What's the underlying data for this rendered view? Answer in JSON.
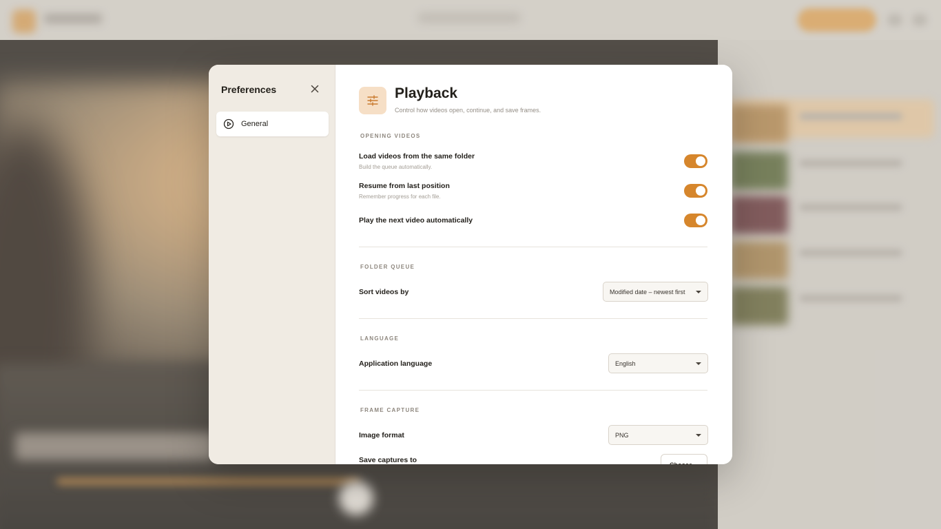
{
  "modal": {
    "title": "Preferences",
    "nav": [
      {
        "label": "General",
        "icon": "play-circle-icon",
        "active": true
      }
    ]
  },
  "page": {
    "title": "Playback",
    "subtitle": "Control how videos open, continue, and save frames.",
    "icon": "sliders-icon"
  },
  "sections": {
    "opening": {
      "label": "OPENING VIDEOS",
      "settings": [
        {
          "title": "Load videos from the same folder",
          "description": "Build the queue automatically.",
          "enabled": true
        },
        {
          "title": "Resume from last position",
          "description": "Remember progress for each file.",
          "enabled": true
        },
        {
          "title": "Play the next video automatically",
          "description": "",
          "enabled": true
        }
      ]
    },
    "queue": {
      "label": "FOLDER QUEUE",
      "sort_label": "Sort videos by",
      "sort_value": "Modified date – newest first"
    },
    "language": {
      "label": "LANGUAGE",
      "app_language_label": "Application language",
      "app_language_value": "English"
    },
    "capture": {
      "label": "FRAME CAPTURE",
      "format_label": "Image format",
      "format_value": "PNG",
      "save_to_label": "Save captures to",
      "choose_label": "Choose…"
    }
  },
  "colors": {
    "accent": "#d6862c",
    "sidebar_bg": "#f0ebe3",
    "icon_tile_bg": "#f6dfc6"
  }
}
